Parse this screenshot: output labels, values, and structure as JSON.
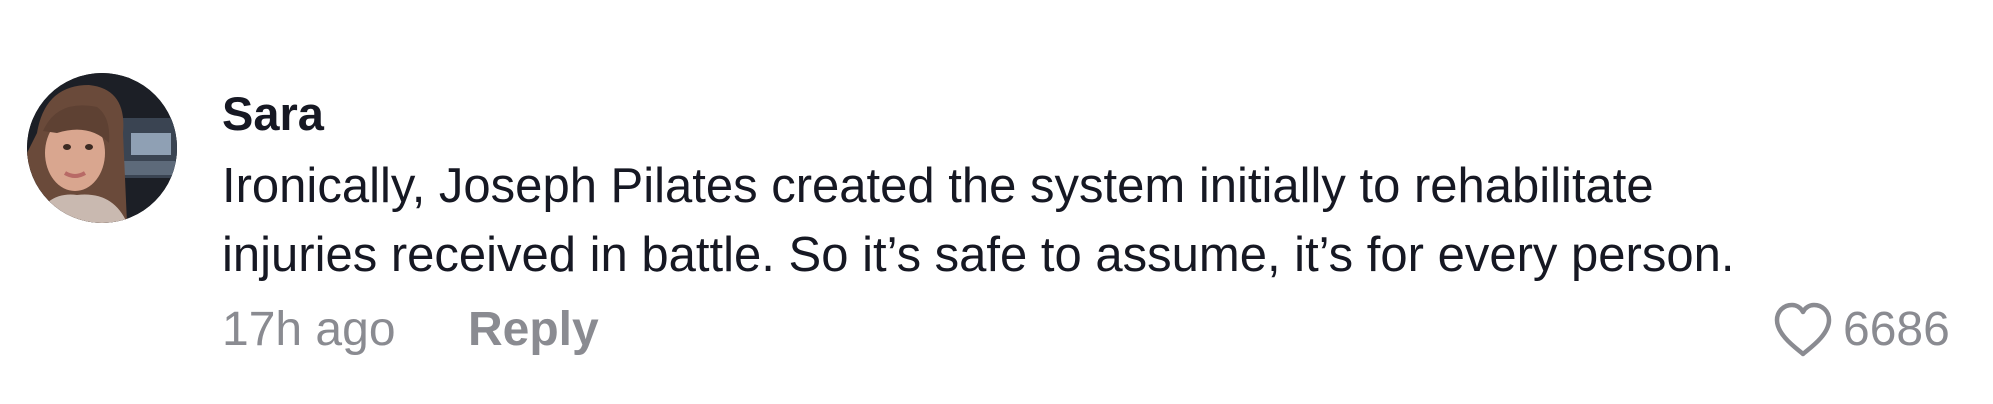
{
  "comment": {
    "username": "Sara",
    "text_lines": [
      "Ironically, Joseph Pilates created the system initially to rehabilitate",
      "injuries received in battle. So it’s safe to assume, it’s for every person."
    ],
    "timestamp": "17h ago",
    "reply_label": "Reply",
    "like_count": "6686",
    "icons": {
      "like": "heart-outline-icon",
      "avatar": "user-avatar-photo"
    }
  },
  "colors": {
    "primary_text": "#161823",
    "secondary_text": "#8a8b91",
    "background": "#ffffff"
  }
}
